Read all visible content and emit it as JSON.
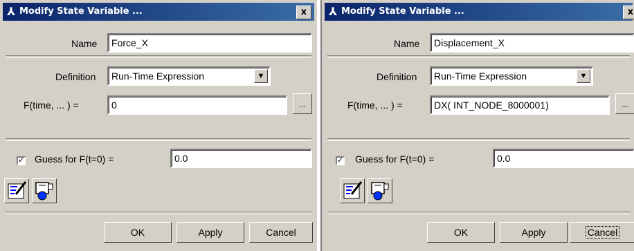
{
  "dialogs": [
    {
      "title": "Modify State Variable ...",
      "close_label": "x",
      "name_label": "Name",
      "name_value": "Force_X",
      "definition_label": "Definition",
      "definition_value": "Run-Time Expression",
      "f_label": "F(time, ... ) =",
      "f_value": "0",
      "more_label": "...",
      "guess_checked": true,
      "guess_label": "Guess for F(t=0) =",
      "guess_value": "0.0",
      "ok_label": "OK",
      "apply_label": "Apply",
      "cancel_label": "Cancel"
    },
    {
      "title": "Modify State Variable ...",
      "close_label": "x",
      "name_label": "Name",
      "name_value": "Displacement_X",
      "definition_label": "Definition",
      "definition_value": "Run-Time Expression",
      "f_label": "F(time, ... ) =",
      "f_value": "DX( INT_NODE_8000001)",
      "more_label": "...",
      "guess_checked": true,
      "guess_label": "Guess for F(t=0) =",
      "guess_value": "0.0",
      "ok_label": "OK",
      "apply_label": "Apply",
      "cancel_label": "Cancel"
    }
  ],
  "icons": {
    "title_icon": "modeling-tool-icon",
    "function_builder": "function-builder-icon",
    "measure": "measure-icon"
  }
}
